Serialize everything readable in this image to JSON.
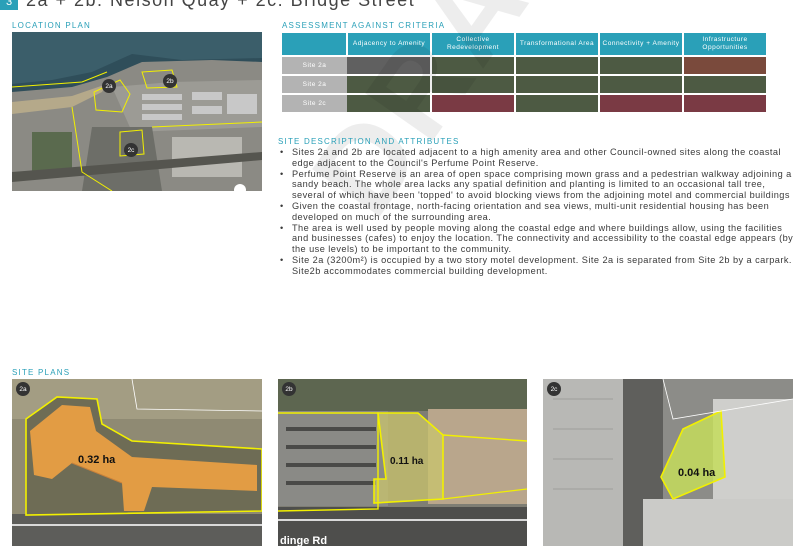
{
  "header": {
    "section_number": "3",
    "title": "2a + 2b: Nelson Quay + 2c: Bridge Street"
  },
  "location_plan": {
    "label": "LOCATION PLAN",
    "markers": [
      "2a",
      "2b",
      "2c"
    ]
  },
  "assessment": {
    "label": "ASSESSMENT AGAINST CRITERIA",
    "columns": [
      "Adjacency to Amenity",
      "Collective Redevelopment",
      "Transformational Area",
      "Connectivity + Amenity",
      "Infrastructure Opportunities"
    ],
    "rows": [
      {
        "label": "Site 2a",
        "colors": [
          "#606060",
          "#4d5a43",
          "#4d5a43",
          "#4d5a43",
          "#7a4a3c"
        ]
      },
      {
        "label": "Site 2a",
        "colors": [
          "#4d5a43",
          "#4d5a43",
          "#4d5a43",
          "#4d5a43",
          "#4d5a43"
        ]
      },
      {
        "label": "Site 2c",
        "colors": [
          "#4d5a43",
          "#7a3a44",
          "#4d5a43",
          "#7a3a44",
          "#7a3a44"
        ]
      }
    ]
  },
  "description": {
    "label": "SITE DESCRIPTION AND ATTRIBUTES",
    "bullets": [
      "Sites 2a and 2b are located adjacent to a high amenity area and other Council-owned sites along the coastal edge adjacent to the Council's Perfume Point Reserve.",
      "Perfume Point Reserve is an area of open space comprising mown grass and a pedestrian walkway adjoining a sandy beach. The whole area lacks any spatial definition and planting is limited to an occasional tall tree, several of which have been 'topped' to avoid blocking views from the adjoining motel and commercial buildings",
      "Given the coastal frontage, north-facing orientation and sea views, multi-unit residential housing has been developed on much of the surrounding area.",
      "The area is well used by people moving along the coastal edge and where buildings allow, using the facilities and businesses (cafes) to enjoy the location. The connectivity and accessibility to the coastal edge appears (by the use levels) to be important to the community.",
      "Site 2a (3200m²) is occupied by a two story motel development. Site 2a is separated from Site 2b by a carpark. Site2b accommodates commercial building development."
    ]
  },
  "site_plans": {
    "label": "SITE PLANS",
    "plans": [
      {
        "tag": "2a",
        "area": "0.32 ha"
      },
      {
        "tag": "2b",
        "area": "0.11 ha",
        "road_label": "dinge Rd"
      },
      {
        "tag": "2c",
        "area": "0.04 ha"
      }
    ]
  },
  "watermark": "DRAFT",
  "colors": {
    "accent": "#2aa0b8",
    "boundary": "#f2f000"
  }
}
